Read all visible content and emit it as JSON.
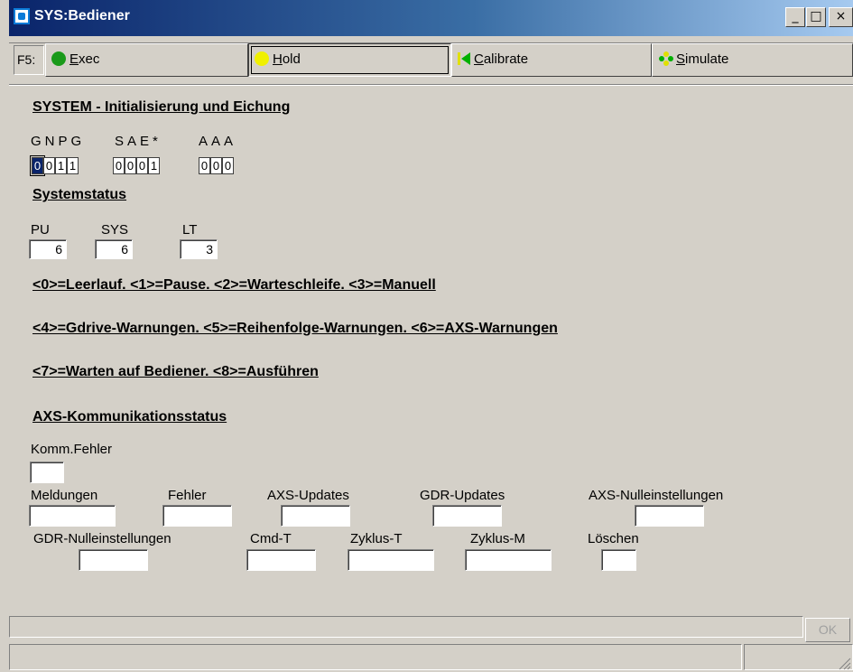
{
  "window": {
    "title": "SYS:Bediener",
    "minimize_glyph": "_",
    "maximize_glyph": "□",
    "close_glyph": "×"
  },
  "toolbar": {
    "fkey": "F5:",
    "exec": {
      "first": "E",
      "rest": "xec",
      "color": "#1a9a1a"
    },
    "hold": {
      "first": "H",
      "rest": "old",
      "color": "#f0f000"
    },
    "calibrate": {
      "first": "C",
      "rest": "alibrate",
      "color": "#00b000"
    },
    "simulate": {
      "first": "S",
      "rest": "imulate",
      "color": "#e0e000"
    }
  },
  "init": {
    "heading": "SYSTEM - Initialisierung und Eichung",
    "groups": [
      {
        "label": "GNPG",
        "bits": [
          "0",
          "0",
          "1",
          "1"
        ]
      },
      {
        "label": "SAE*",
        "bits": [
          "0",
          "0",
          "0",
          "1"
        ]
      },
      {
        "label": "AAA",
        "bits": [
          "0",
          "0",
          "0"
        ]
      }
    ]
  },
  "status": {
    "heading": "Systemstatus",
    "fields": [
      {
        "label": "PU",
        "value": "6"
      },
      {
        "label": "SYS",
        "value": "6"
      },
      {
        "label": "LT",
        "value": "3"
      }
    ],
    "legend": [
      "<0>=Leerlauf. <1>=Pause. <2>=Warteschleife. <3>=Manuell",
      "<4>=Gdrive-Warnungen. <5>=Reihenfolge-Warnungen. <6>=AXS-Warnungen",
      "<7>=Warten auf Bediener. <8>=Ausführen"
    ]
  },
  "axs": {
    "heading": "AXS-Kommunikationsstatus",
    "comm_error": "Komm.Fehler",
    "row1": [
      "Meldungen",
      "Fehler",
      "AXS-Updates",
      "GDR-Updates",
      "AXS-Nulleinstellungen"
    ],
    "row2": [
      "GDR-Nulleinstellungen",
      "Cmd-T",
      "Zyklus-T",
      "Zyklus-M",
      "Löschen"
    ]
  },
  "footer": {
    "ok": "OK"
  }
}
